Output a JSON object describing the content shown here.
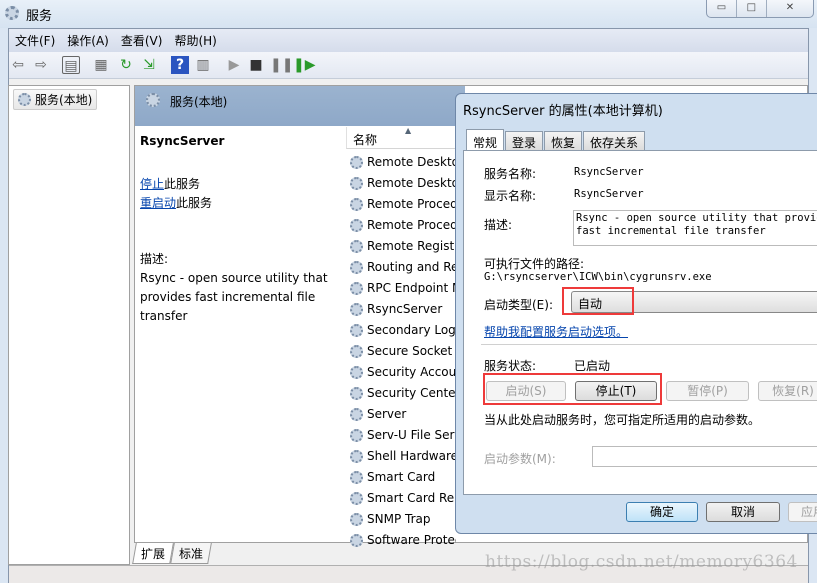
{
  "window": {
    "title": "服务",
    "controls": [
      "minimize",
      "maximize",
      "close"
    ]
  },
  "menu": [
    "文件(F)",
    "操作(A)",
    "查看(V)",
    "帮助(H)"
  ],
  "toolbar_icons": [
    "back-icon",
    "forward-icon",
    "show-hide-tree-icon",
    "properties-icon",
    "refresh-icon",
    "export-icon",
    "help-icon",
    "console-icon",
    "start-icon",
    "stop-icon",
    "pause-icon",
    "restart-icon"
  ],
  "tree": {
    "root": "服务(本地)"
  },
  "main": {
    "header": "服务(本地)",
    "selected_name": "RsyncServer",
    "stop_link": "停止",
    "stop_suffix": "此服务",
    "restart_link": "重启动",
    "restart_suffix": "此服务",
    "desc_label": "描述:",
    "desc_text": "Rsync - open source utility that provides fast incremental file transfer",
    "column_name": "名称",
    "services": [
      "Remote Desktop",
      "Remote Desktop",
      "Remote Procedure",
      "Remote Procedure",
      "Remote Registry",
      "Routing and Re",
      "RPC Endpoint M",
      "RsyncServer",
      "Secondary Logon",
      "Secure Socket",
      "Security Accounts",
      "Security Center",
      "Server",
      "Serv-U File Server",
      "Shell Hardware",
      "Smart Card",
      "Smart Card Re",
      "SNMP Trap",
      "Software Protect"
    ],
    "bottom_tabs": [
      "扩展",
      "标准"
    ]
  },
  "dialog": {
    "title": "RsyncServer 的属性(本地计算机)",
    "tabs": [
      "常规",
      "登录",
      "恢复",
      "依存关系"
    ],
    "service_name_label": "服务名称:",
    "service_name": "RsyncServer",
    "display_name_label": "显示名称:",
    "display_name": "RsyncServer",
    "desc_label": "描述:",
    "desc_text": "Rsync - open source utility that provides\nfast incremental file transfer",
    "path_label": "可执行文件的路径:",
    "path": "G:\\rsyncserver\\ICW\\bin\\cygrunsrv.exe",
    "startup_type_label": "启动类型(E):",
    "startup_type": "自动",
    "help_link": "帮助我配置服务启动选项。",
    "status_label": "服务状态:",
    "status": "已启动",
    "start_btn": "启动(S)",
    "stop_btn": "停止(T)",
    "pause_btn": "暂停(P)",
    "resume_btn": "恢复(R)",
    "hint": "当从此处启动服务时，您可指定所适用的启动参数。",
    "params_label": "启动参数(M):",
    "params_value": "",
    "ok": "确定",
    "cancel": "取消",
    "apply": "应用"
  },
  "highlight_color": "#ee3a3a",
  "watermark": "https://blog.csdn.net/memory6364"
}
